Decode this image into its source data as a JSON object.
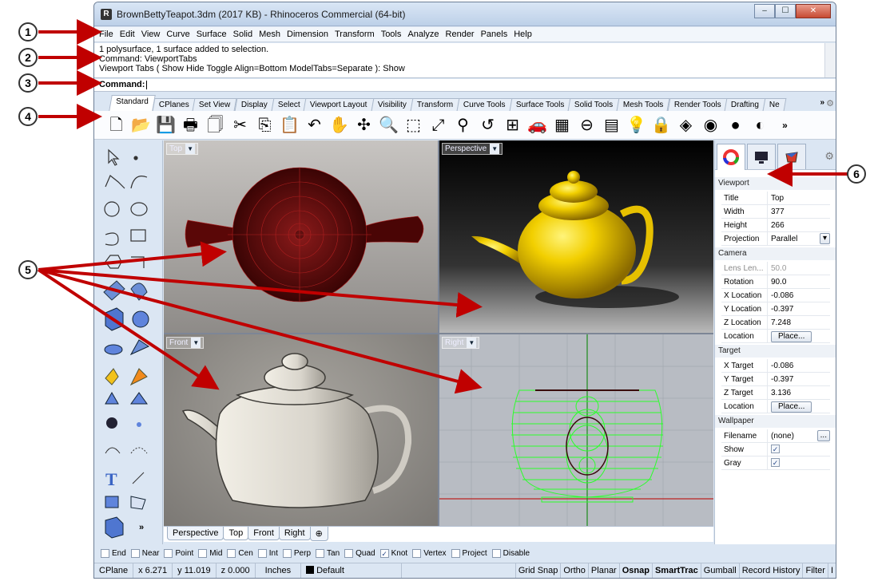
{
  "window": {
    "title": "BrownBettyTeapot.3dm (2017 KB) - Rhinoceros Commercial (64-bit)",
    "minimize": "–",
    "maximize": "☐",
    "close": "✕"
  },
  "menu": [
    "File",
    "Edit",
    "View",
    "Curve",
    "Surface",
    "Solid",
    "Mesh",
    "Dimension",
    "Transform",
    "Tools",
    "Analyze",
    "Render",
    "Panels",
    "Help"
  ],
  "history": {
    "line1": "1 polysurface, 1 surface added to selection.",
    "line2": "Command: ViewportTabs",
    "line3": "Viewport Tabs ( Show  Hide  Toggle  Align=Bottom  ModelTabs=Separate ): Show"
  },
  "command": {
    "label": "Command:"
  },
  "toolbar_tabs": [
    "Standard",
    "CPlanes",
    "Set View",
    "Display",
    "Select",
    "Viewport Layout",
    "Visibility",
    "Transform",
    "Curve Tools",
    "Surface Tools",
    "Solid Tools",
    "Mesh Tools",
    "Render Tools",
    "Drafting",
    "Ne"
  ],
  "toolbar_more": "»",
  "toolbar_icons": [
    "new-file",
    "open-folder",
    "save-disk",
    "print",
    "import",
    "cut",
    "copy",
    "paste",
    "undo",
    "pan",
    "rotate-view",
    "zoom",
    "zoom-window",
    "zoom-extents",
    "zoom-selected",
    "undo-view",
    "four-viewports",
    "car",
    "grid",
    "cplane",
    "layers",
    "light",
    "lock",
    "render",
    "color-wheel",
    "sphere-material",
    "sphere-render"
  ],
  "toolbar_icon_glyphs": [
    "🗋",
    "📂",
    "💾",
    "🖶",
    "🗍",
    "✂",
    "⎘",
    "📋",
    "↶",
    "✋",
    "✣",
    "🔍",
    "⬚",
    "⤢",
    "⚲",
    "↺",
    "⊞",
    "🚗",
    "▦",
    "⊖",
    "▤",
    "💡",
    "🔒",
    "◈",
    "◉",
    "●",
    "◐"
  ],
  "toolbar_end": "»",
  "viewports": [
    {
      "id": "top",
      "label": "Top"
    },
    {
      "id": "perspective",
      "label": "Perspective"
    },
    {
      "id": "front",
      "label": "Front"
    },
    {
      "id": "right",
      "label": "Right"
    }
  ],
  "viewport_tabs": [
    "Perspective",
    "Top",
    "Front",
    "Right"
  ],
  "viewport_tab_active": "Top",
  "viewport_tab_add": "⊕",
  "left_toolbar_more": "»",
  "panel": {
    "sections": {
      "viewport": "Viewport",
      "camera": "Camera",
      "target": "Target",
      "wallpaper": "Wallpaper"
    },
    "viewport_rows": [
      {
        "key": "Title",
        "value": "Top"
      },
      {
        "key": "Width",
        "value": "377"
      },
      {
        "key": "Height",
        "value": "266"
      },
      {
        "key": "Projection",
        "value": "Parallel"
      }
    ],
    "camera_rows": [
      {
        "key": "Lens Len...",
        "value": "50.0"
      },
      {
        "key": "Rotation",
        "value": "90.0"
      },
      {
        "key": "X Location",
        "value": "-0.086"
      },
      {
        "key": "Y Location",
        "value": "-0.397"
      },
      {
        "key": "Z Location",
        "value": "7.248"
      },
      {
        "key": "Location",
        "value": "Place..."
      }
    ],
    "target_rows": [
      {
        "key": "X Target",
        "value": "-0.086"
      },
      {
        "key": "Y Target",
        "value": "-0.397"
      },
      {
        "key": "Z Target",
        "value": "3.136"
      },
      {
        "key": "Location",
        "value": "Place..."
      }
    ],
    "wallpaper_rows": [
      {
        "key": "Filename",
        "value": "(none)"
      },
      {
        "key": "Show",
        "value": "✓"
      },
      {
        "key": "Gray",
        "value": "✓"
      }
    ],
    "dropdown": "▾",
    "browse": "..."
  },
  "osnaps": [
    {
      "label": "End",
      "checked": false
    },
    {
      "label": "Near",
      "checked": false
    },
    {
      "label": "Point",
      "checked": false
    },
    {
      "label": "Mid",
      "checked": false
    },
    {
      "label": "Cen",
      "checked": false
    },
    {
      "label": "Int",
      "checked": false
    },
    {
      "label": "Perp",
      "checked": false
    },
    {
      "label": "Tan",
      "checked": false
    },
    {
      "label": "Quad",
      "checked": false
    },
    {
      "label": "Knot",
      "checked": true
    },
    {
      "label": "Vertex",
      "checked": false
    }
  ],
  "osnap_buttons": [
    "Project",
    "Disable"
  ],
  "check_mark": "✓",
  "status": {
    "cplane": "CPlane",
    "x": "x 6.271",
    "y": "y 11.019",
    "z": "z 0.000",
    "units": "Inches",
    "layer": "Default",
    "grid_snap": "Grid Snap",
    "ortho": "Ortho",
    "planar": "Planar",
    "osnap": "Osnap",
    "smarttrack": "SmartTrac",
    "gumball": "Gumball",
    "record_history": "Record History",
    "filter": "Filter",
    "tail": "I"
  },
  "callouts": [
    "1",
    "2",
    "3",
    "4",
    "5",
    "6"
  ],
  "colors": {
    "arrow": "#c00000",
    "teapot_gold": "#f2cf00",
    "wire_green": "#2bff2b",
    "dark_red": "#6e0b0b"
  }
}
